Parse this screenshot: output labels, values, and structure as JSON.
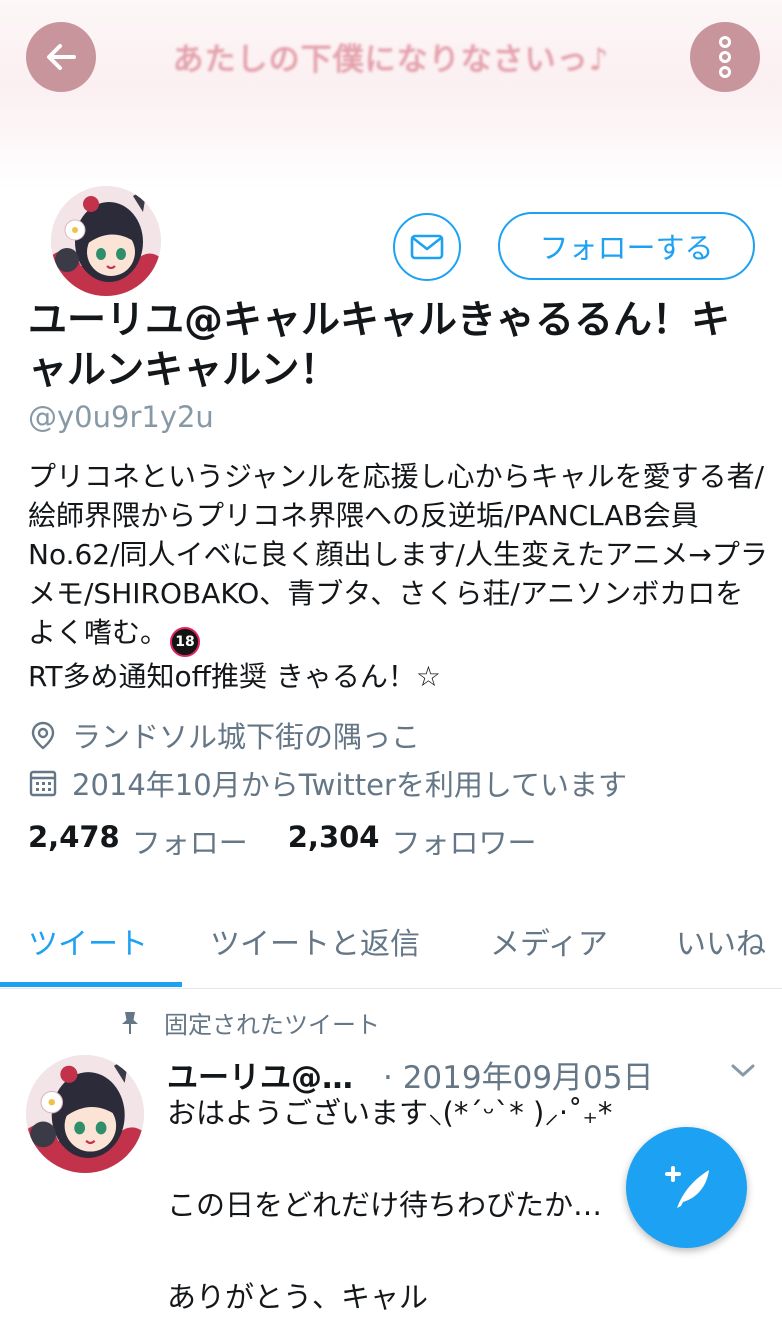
{
  "header": {
    "banner_text": "あたしの下僕になりなさいっ♪",
    "back_icon": "arrow-left-icon",
    "more_icon": "more-vertical-icon"
  },
  "profile": {
    "display_name": "ユーリユ@キャルキャルきゃるるん！キャルンキャルン！",
    "handle": "@y0u9r1y2u",
    "bio": "プリコネというジャンルを応援し心からキャルを愛する者/絵師界隈からプリコネ界隈への反逆垢/PANCLAB会員No.62/同人イベに良く顔出します/人生変えたアニメ→プラメモ/SHIROBAKO、青ブタ、さくら荘/アニソンボカロをよく嗜む。",
    "bio_badge": "18",
    "bio_tail": "RT多め通知off推奨 きゃるん！☆",
    "location": "ランドソル城下街の隅っこ",
    "joined": "2014年10月からTwitterを利用しています",
    "following_count": "2,478",
    "following_label": "フォロー",
    "followers_count": "2,304",
    "followers_label": "フォロワー"
  },
  "actions": {
    "follow_label": "フォローする",
    "message_icon": "mail-icon"
  },
  "tabs": [
    {
      "label": "ツイート",
      "active": true
    },
    {
      "label": "ツイートと返信",
      "active": false
    },
    {
      "label": "メディア",
      "active": false
    },
    {
      "label": "いいね",
      "active": false
    }
  ],
  "pinned_tweet": {
    "pinned_label": "固定されたツイート",
    "author": "ユーリユ@…",
    "date": "· 2019年09月05日",
    "text": "おはようございます⸜(*ˊᵕˋ* )⸝‧˚₊*\n\nこの日をどれだけ待ちわびたか…\n\nありがとう、キャル"
  },
  "fab": {
    "icon": "compose-tweet-icon"
  },
  "colors": {
    "accent": "#1da1f2",
    "header_button": "#c9959c",
    "muted_text": "#657786"
  }
}
